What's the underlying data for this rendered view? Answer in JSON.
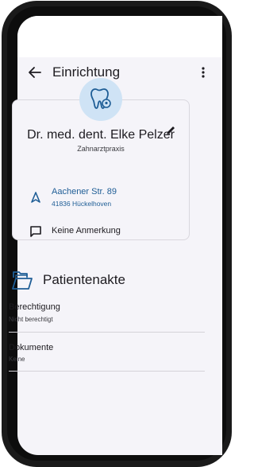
{
  "header": {
    "title": "Einrichtung"
  },
  "practice": {
    "name": "Dr. med. dent. Elke Pelzer",
    "type": "Zahnarztpraxis",
    "street": "Aachener Str. 89",
    "city": "41836 Hückelhoven",
    "note": "Keine Anmerkung"
  },
  "section": {
    "title": "Patientenakte"
  },
  "rows": [
    {
      "label": "Berechtigung",
      "value": "Nicht berechtigt"
    },
    {
      "label": "Dokumente",
      "value": "Keine"
    }
  ],
  "colors": {
    "accent": "#1f5e96",
    "avatar_bg": "#cfe3f5",
    "frame": "#1a1a1a"
  },
  "icons": [
    "back-arrow-icon",
    "more-vert-icon",
    "tooth-icon",
    "edit-pencil-icon",
    "navigation-icon",
    "comment-icon",
    "folder-icon"
  ]
}
